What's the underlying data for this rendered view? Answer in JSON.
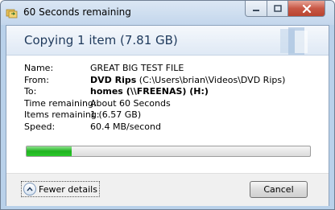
{
  "window": {
    "title": "60 Seconds remaining"
  },
  "header": {
    "text": "Copying 1 item (7.81 GB)"
  },
  "details": {
    "name_label": "Name:",
    "name_value": "GREAT BIG TEST FILE",
    "from_label": "From:",
    "from_bold": "DVD Rips",
    "from_path": " (C:\\Users\\brian\\Videos\\DVD Rips)",
    "to_label": "To:",
    "to_value": "homes (\\\\FREENAS) (H:)",
    "time_label": "Time remaining:",
    "time_value": "About 60 Seconds",
    "items_label": "Items remaining:",
    "items_value": "1 (6.57 GB)",
    "speed_label": "Speed:",
    "speed_value": "60.4 MB/second"
  },
  "progress": {
    "fraction": 0.16
  },
  "footer": {
    "toggle_label": "Fewer details",
    "cancel_label": "Cancel"
  },
  "icons": {
    "title": "copy-folder-icon",
    "toggle": "chevron-up-icon"
  }
}
